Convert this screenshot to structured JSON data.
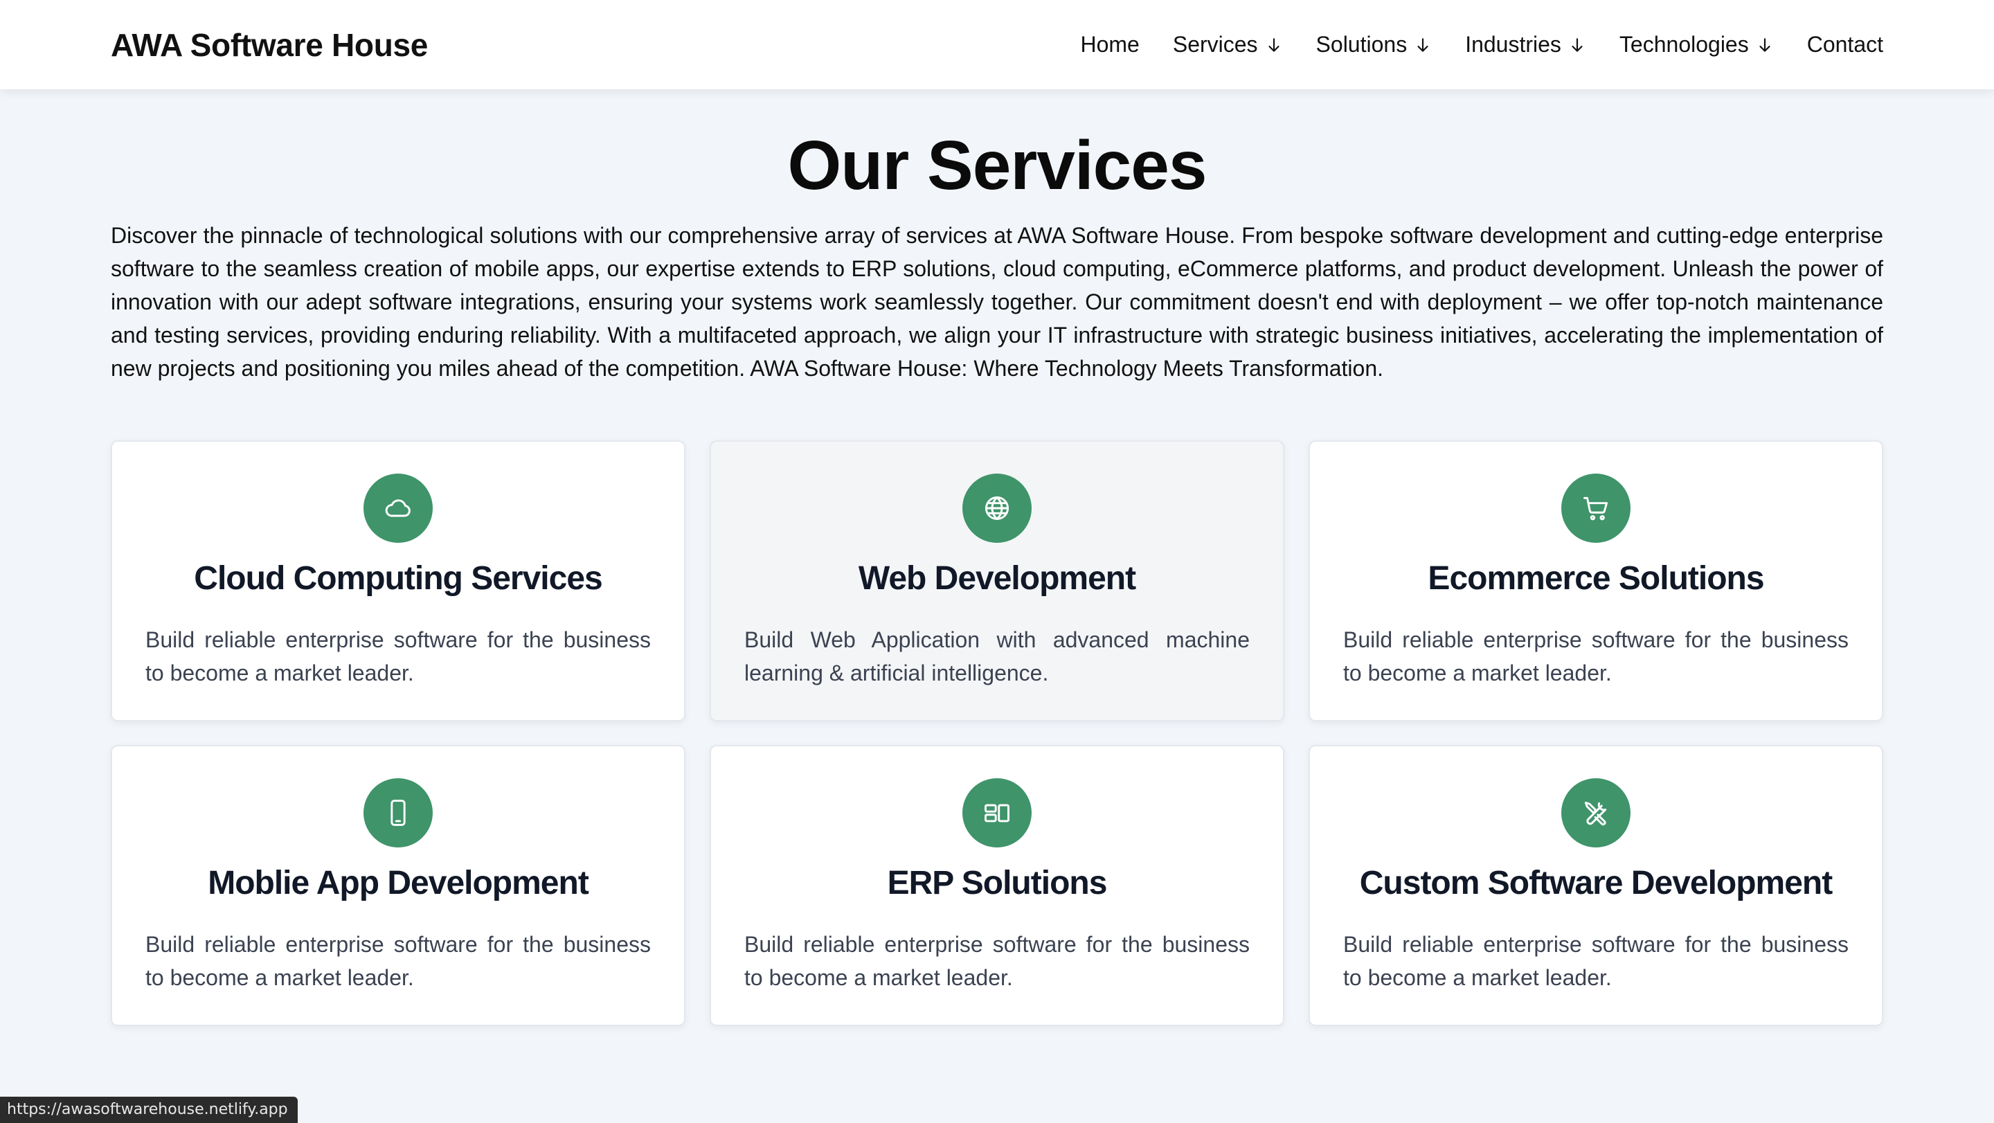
{
  "brand": "AWA Software House",
  "nav": [
    {
      "label": "Home",
      "dropdown": false
    },
    {
      "label": "Services",
      "dropdown": true
    },
    {
      "label": "Solutions",
      "dropdown": true
    },
    {
      "label": "Industries",
      "dropdown": true
    },
    {
      "label": "Technologies",
      "dropdown": true
    },
    {
      "label": "Contact",
      "dropdown": false
    }
  ],
  "page_title": "Our Services",
  "intro": "Discover the pinnacle of technological solutions with our comprehensive array of services at AWA Software House. From bespoke software development and cutting-edge enterprise software to the seamless creation of mobile apps, our expertise extends to ERP solutions, cloud computing, eCommerce platforms, and product development. Unleash the power of innovation with our adept software integrations, ensuring your systems work seamlessly together. Our commitment doesn't end with deployment – we offer top-notch maintenance and testing services, providing enduring reliability. With a multifaceted approach, we align your IT infrastructure with strategic business initiatives, accelerating the implementation of new projects and positioning you miles ahead of the competition. AWA Software House: Where Technology Meets Transformation.",
  "services": [
    {
      "icon": "cloud-icon",
      "title": "Cloud Computing Services",
      "desc": "Build reliable enterprise software for the business to become a market leader."
    },
    {
      "icon": "globe-icon",
      "title": "Web Development",
      "desc": "Build Web Application with advanced machine learning & artificial intelligence."
    },
    {
      "icon": "cart-icon",
      "title": "Ecommerce Solutions",
      "desc": "Build reliable enterprise software for the business to become a market leader."
    },
    {
      "icon": "phone-icon",
      "title": "Moblie App Development",
      "desc": "Build reliable enterprise software for the business to become a market leader."
    },
    {
      "icon": "layout-icon",
      "title": "ERP Solutions",
      "desc": "Build reliable enterprise software for the business to become a market leader."
    },
    {
      "icon": "tools-icon",
      "title": "Custom Software Development",
      "desc": "Build reliable enterprise software for the business to become a market leader."
    }
  ],
  "status_url": "https://awasoftwarehouse.netlify.app",
  "colors": {
    "accent": "#3f946a",
    "background": "#f2f5f9",
    "card": "#ffffff"
  }
}
